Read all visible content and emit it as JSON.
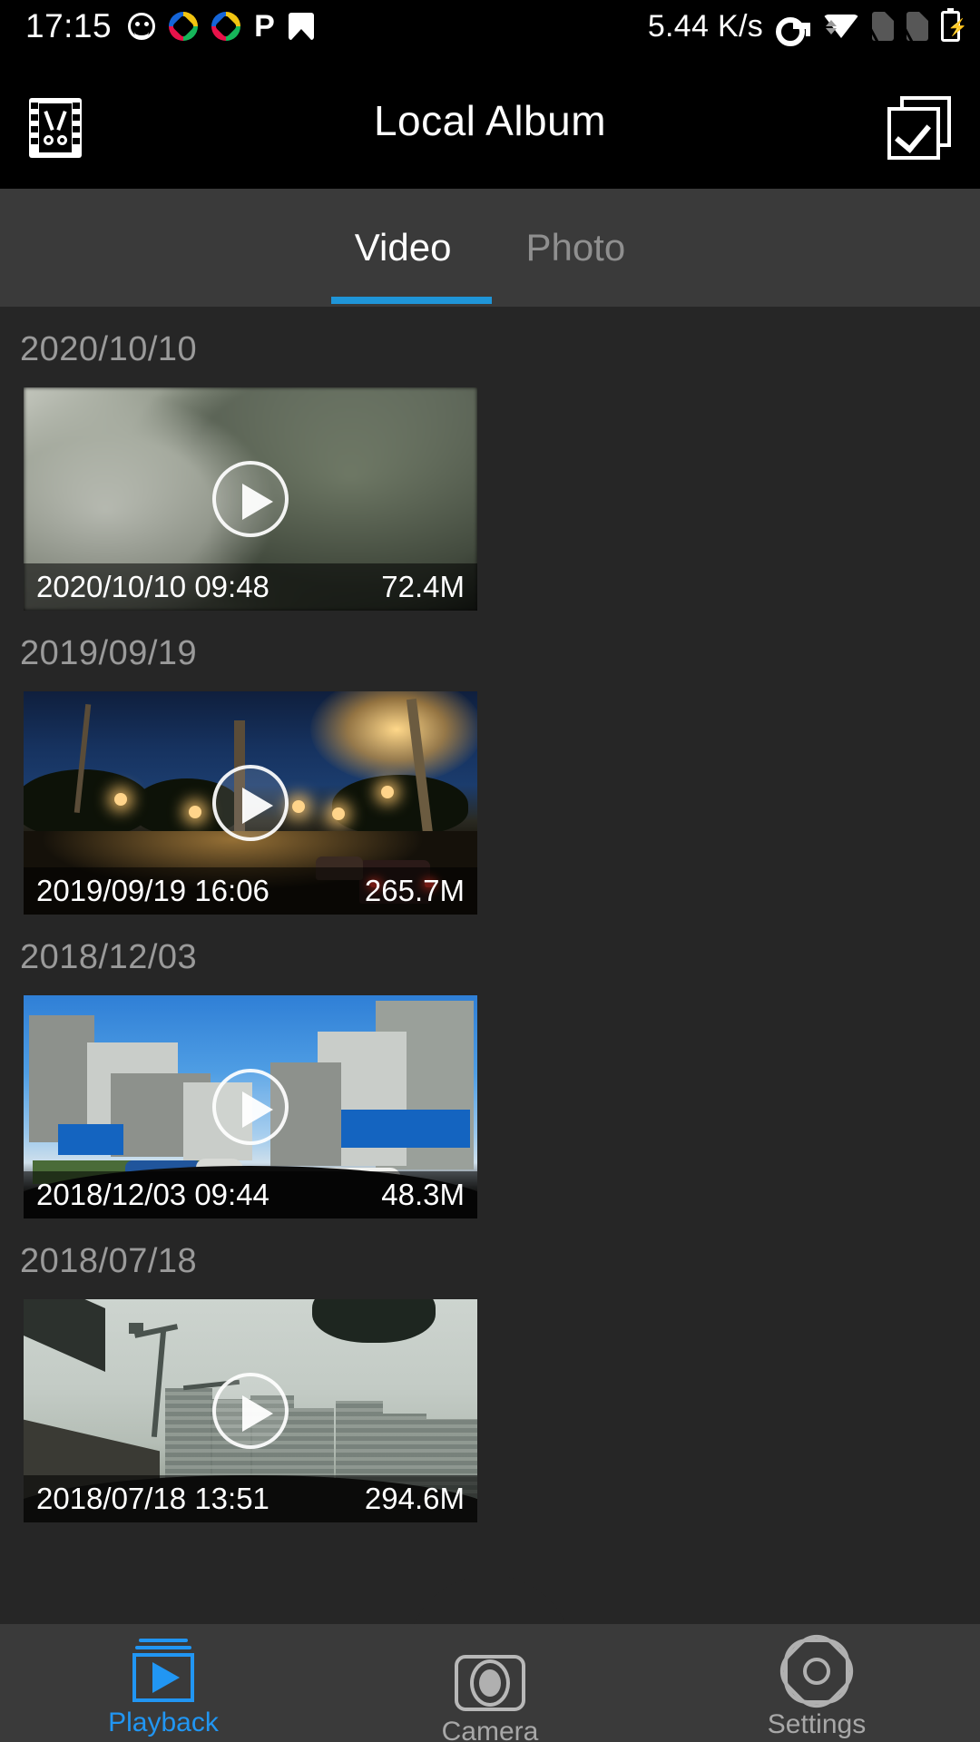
{
  "status_bar": {
    "time": "17:15",
    "network_speed": "5.44 K/s",
    "left_icons": [
      "smiley-icon",
      "pinwheel-logo-icon",
      "pinwheel-logo-icon",
      "letter-p-icon",
      "photo-icon"
    ],
    "right_icons": [
      "vpn-key-icon",
      "wifi-icon",
      "sim-card-off-icon",
      "sim-card-off-icon",
      "battery-charging-icon"
    ]
  },
  "header": {
    "title": "Local Album",
    "left_icon": "film-cut-icon",
    "right_icon": "select-all-checkbox-icon"
  },
  "tabs": {
    "items": [
      {
        "label": "Video",
        "active": true
      },
      {
        "label": "Photo",
        "active": false
      }
    ],
    "accent_color": "#1f95d8"
  },
  "groups": [
    {
      "date": "2020/10/10",
      "items": [
        {
          "timestamp": "2020/10/10 09:48",
          "size": "72.4M",
          "scene": "s1"
        }
      ]
    },
    {
      "date": "2019/09/19",
      "items": [
        {
          "timestamp": "2019/09/19 16:06",
          "size": "265.7M",
          "scene": "s2"
        }
      ]
    },
    {
      "date": "2018/12/03",
      "items": [
        {
          "timestamp": "2018/12/03 09:44",
          "size": "48.3M",
          "scene": "s3"
        }
      ]
    },
    {
      "date": "2018/07/18",
      "items": [
        {
          "timestamp": "2018/07/18 13:51",
          "size": "294.6M",
          "scene": "s4"
        }
      ]
    }
  ],
  "bottom_nav": {
    "items": [
      {
        "label": "Playback",
        "icon": "playback-icon",
        "active": true
      },
      {
        "label": "Camera",
        "icon": "camera-icon",
        "active": false
      },
      {
        "label": "Settings",
        "icon": "gear-icon",
        "active": false
      }
    ],
    "active_color": "#2196f3"
  }
}
